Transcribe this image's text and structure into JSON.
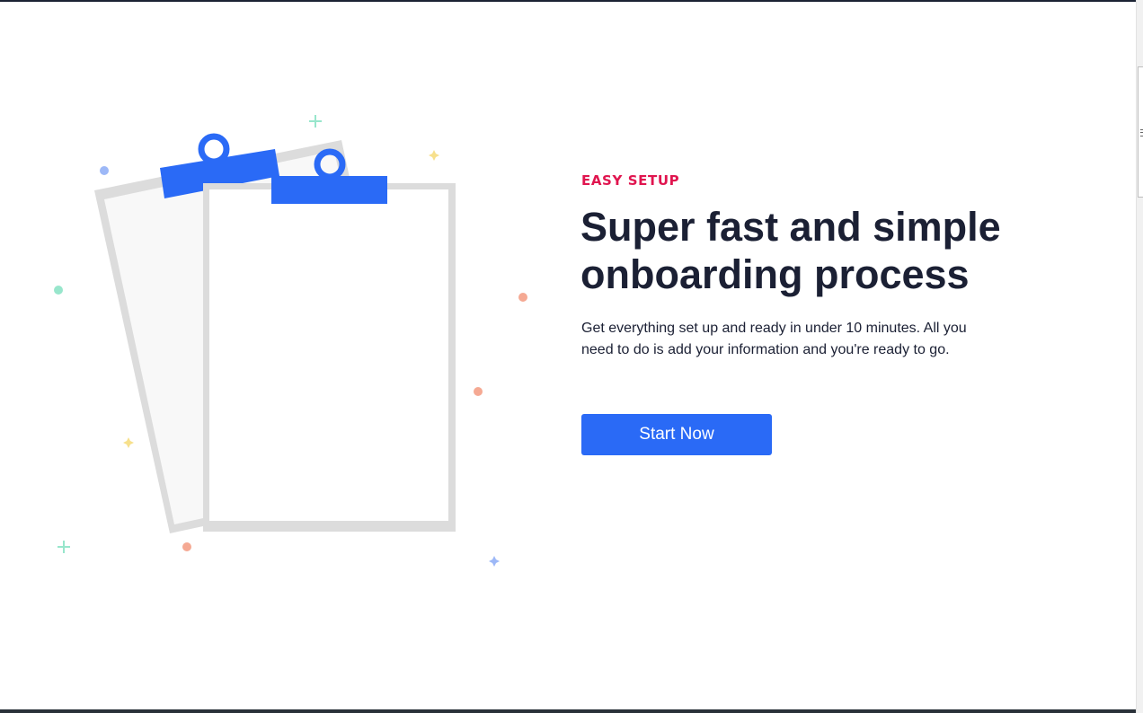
{
  "hero": {
    "eyebrow": "EASY SETUP",
    "headline": "Super fast and simple onboarding process",
    "description": "Get everything set up and ready in under 10 minutes. All you need to do is add your information and you're ready to go.",
    "cta_label": "Start Now"
  },
  "illustration": {
    "icon": "clipboards-illustration"
  },
  "colors": {
    "accent": "#e0154f",
    "primary": "#2a6af6",
    "heading": "#1b2034",
    "clipboard_frame": "#dcdcdc"
  }
}
